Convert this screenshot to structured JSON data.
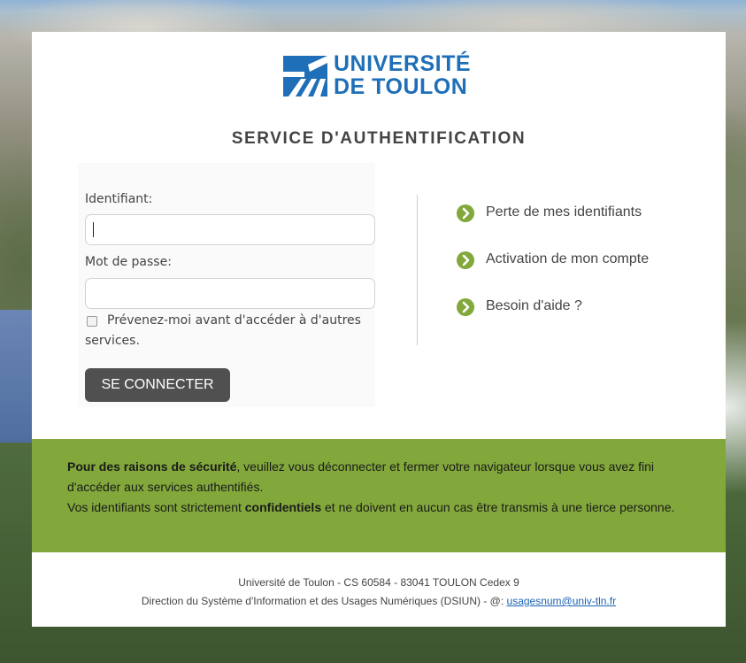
{
  "branding": {
    "logo_line1": "UNIVERSITÉ",
    "logo_line2": "DE TOULON",
    "logo_color": "#1f6fb8",
    "service_title": "SERVICE D'AUTHENTIFICATION"
  },
  "form": {
    "username_label": "Identifiant:",
    "username_value": "",
    "password_label": "Mot de passe:",
    "password_value": "",
    "warn_label_line1": "Prévenez-moi avant d'accéder à d'autres",
    "warn_label_line2": "services.",
    "warn_checked": false,
    "submit_label": "SE CONNECTER"
  },
  "help_links": [
    {
      "label": "Perte de mes identifiants",
      "icon": "chevron-right-circle-icon"
    },
    {
      "label": "Activation de mon compte",
      "icon": "chevron-right-circle-icon"
    },
    {
      "label": "Besoin d'aide ?",
      "icon": "chevron-right-circle-icon"
    }
  ],
  "security_notice": {
    "strong1": "Pour des raisons de sécurité",
    "text1": ", veuillez vous déconnecter et fermer votre navigateur lorsque vous avez fini d'accéder aux services authentifiés.",
    "text2_pre": "Vos identifiants sont strictement ",
    "strong2": "confidentiels",
    "text2_post": " et ne doivent en aucun cas être transmis à une tierce personne."
  },
  "footer": {
    "address": "Université de Toulon - CS 60584 - 83041 TOULON Cedex 9",
    "direction": "Direction du Système d'Information et des Usages Numériques (DSIUN) - @: ",
    "email": "usagesnum@univ-tln.fr"
  },
  "colors": {
    "accent_green": "#82a83b",
    "button_dark": "#505050"
  }
}
